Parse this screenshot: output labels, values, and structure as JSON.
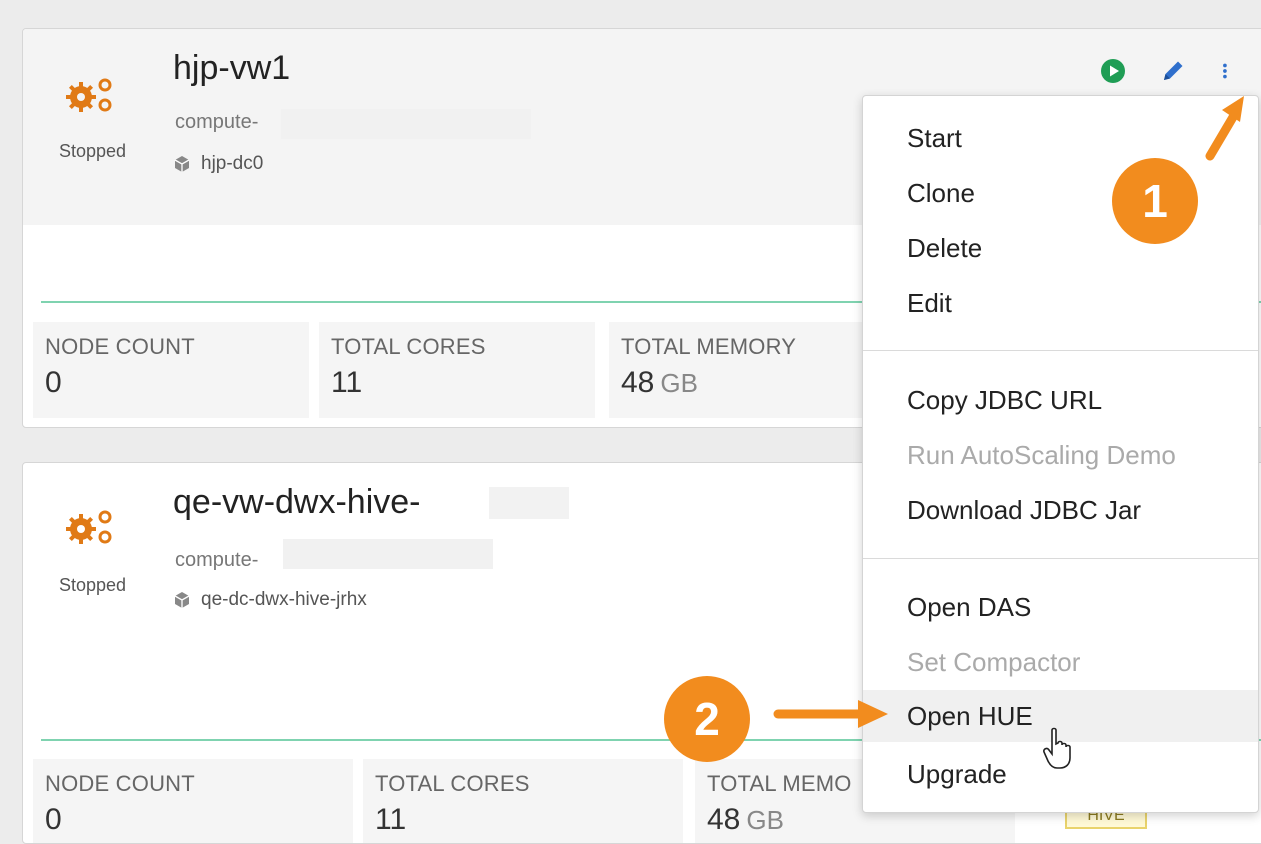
{
  "warehouses": [
    {
      "name": "hjp-vw1",
      "status": "Stopped",
      "compute": "compute-",
      "database": "hjp-dc0",
      "stats": {
        "node_count_label": "NODE COUNT",
        "node_count": "0",
        "total_cores_label": "TOTAL CORES",
        "total_cores": "11",
        "total_memory_label": "TOTAL MEMORY",
        "total_memory": "48",
        "memory_unit": "GB"
      }
    },
    {
      "name": "qe-vw-dwx-hive-",
      "status": "Stopped",
      "compute": "compute-",
      "database": "qe-dc-dwx-hive-jrhx",
      "stats": {
        "node_count_label": "NODE COUNT",
        "node_count": "0",
        "total_cores_label": "TOTAL CORES",
        "total_cores": "11",
        "total_memory_label": "TOTAL MEMO",
        "total_memory": "48",
        "memory_unit": "GB"
      },
      "type_badge": "HIVE"
    }
  ],
  "actions": {
    "start_icon": "play-circle-icon",
    "edit_icon": "pencil-icon",
    "more_icon": "kebab-menu-icon"
  },
  "menu": {
    "items": [
      {
        "label": "Start",
        "enabled": true
      },
      {
        "label": "Clone",
        "enabled": true
      },
      {
        "label": "Delete",
        "enabled": true
      },
      {
        "label": "Edit",
        "enabled": true
      },
      {
        "label": "Copy JDBC URL",
        "enabled": true
      },
      {
        "label": "Run AutoScaling Demo",
        "enabled": false
      },
      {
        "label": "Download JDBC Jar",
        "enabled": true
      },
      {
        "label": "Open DAS",
        "enabled": true
      },
      {
        "label": "Set Compactor",
        "enabled": false
      },
      {
        "label": "Open HUE",
        "enabled": true,
        "hovered": true
      },
      {
        "label": "Upgrade",
        "enabled": true
      }
    ]
  },
  "annotations": {
    "step1": "1",
    "step2": "2"
  },
  "colors": {
    "accent_orange": "#f28c1e",
    "play_green": "#1f9d55",
    "edit_blue": "#2f6fcc",
    "progress_green": "#7fd3b0"
  }
}
